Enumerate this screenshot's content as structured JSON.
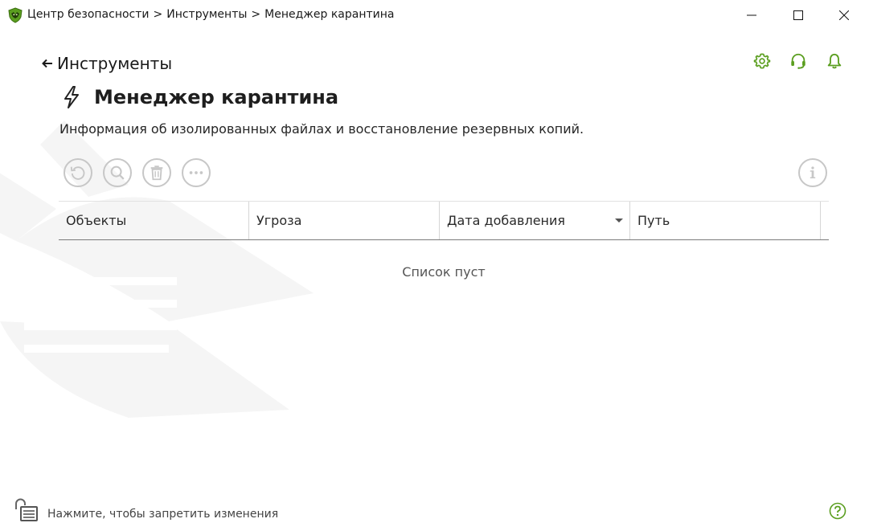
{
  "window": {
    "breadcrumb": [
      "Центр безопасности",
      "Инструменты",
      "Менеджер карантина"
    ],
    "breadcrumb_separator": ">"
  },
  "header": {
    "back_label": "Инструменты",
    "title": "Менеджер карантина",
    "description": "Информация об изолированных файлах и восстановление резервных копий."
  },
  "toolbar": {
    "icons": [
      "restore-icon",
      "search-icon",
      "trash-icon",
      "more-icon",
      "info-icon"
    ]
  },
  "table": {
    "columns": [
      "Объекты",
      "Угроза",
      "Дата добавления",
      "Путь"
    ],
    "sorted_column": "Дата добавления",
    "rows": [],
    "empty_message": "Список пуст"
  },
  "footer": {
    "lock_text": "Нажмите, чтобы запретить изменения"
  },
  "colors": {
    "accent_green": "#5a9e1f",
    "toolbar_disabled": "#c7c7c7",
    "watermark": "#f6f6f6"
  }
}
